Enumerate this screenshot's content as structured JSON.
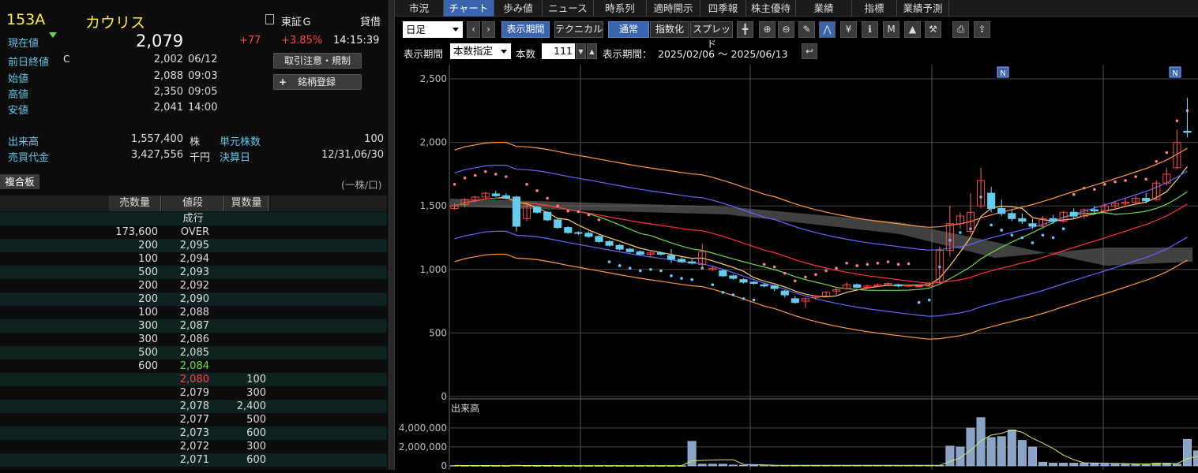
{
  "stock": {
    "code": "153A",
    "name": "カウリス",
    "market": "東証Ｇ",
    "lending": "貸借"
  },
  "quote": {
    "current_label": "現在値",
    "current_value": "2,079",
    "change": "+77",
    "change_pct": "+3.85%",
    "time": "14:15:39",
    "prev_close_label": "前日終値",
    "prev_close_mark": "C",
    "prev_close_value": "2,002",
    "prev_close_date": "06/12",
    "open_label": "始値",
    "open_value": "2,088",
    "open_time": "09:03",
    "high_label": "高値",
    "high_value": "2,350",
    "high_time": "09:05",
    "low_label": "安値",
    "low_value": "2,041",
    "low_time": "14:00",
    "volume_label": "出来高",
    "volume_value": "1,557,400",
    "volume_unit": "株",
    "unit_shares_label": "単元株数",
    "unit_shares_value": "100",
    "turnover_label": "売買代金",
    "turnover_value": "3,427,556",
    "turnover_unit": "千円",
    "settlement_label": "決算日",
    "settlement_value": "12/31,06/30"
  },
  "buttons": {
    "notice": "取引注意・規制",
    "register": "銘柄登録",
    "register_icon": "plus-icon"
  },
  "board": {
    "tab": "複合板",
    "unit_note": "(一株/口)",
    "headers": [
      "売数量",
      "値段",
      "買数量"
    ],
    "rows": [
      {
        "sell": "",
        "price": "成行",
        "buy": "",
        "price_color": "#dddddd"
      },
      {
        "sell": "173,600",
        "price": "OVER",
        "buy": "",
        "price_color": "#dddddd"
      },
      {
        "sell": "200",
        "price": "2,095",
        "buy": "",
        "price_color": "#dddddd"
      },
      {
        "sell": "100",
        "price": "2,094",
        "buy": "",
        "price_color": "#dddddd"
      },
      {
        "sell": "500",
        "price": "2,093",
        "buy": "",
        "price_color": "#dddddd"
      },
      {
        "sell": "200",
        "price": "2,092",
        "buy": "",
        "price_color": "#dddddd"
      },
      {
        "sell": "200",
        "price": "2,090",
        "buy": "",
        "price_color": "#dddddd"
      },
      {
        "sell": "100",
        "price": "2,088",
        "buy": "",
        "price_color": "#dddddd"
      },
      {
        "sell": "300",
        "price": "2,087",
        "buy": "",
        "price_color": "#dddddd"
      },
      {
        "sell": "300",
        "price": "2,086",
        "buy": "",
        "price_color": "#dddddd"
      },
      {
        "sell": "500",
        "price": "2,085",
        "buy": "",
        "price_color": "#dddddd"
      },
      {
        "sell": "600",
        "price": "2,084",
        "buy": "",
        "price_color": "#66dd44"
      },
      {
        "sell": "",
        "price": "2,080",
        "buy": "100",
        "price_color": "#ff4444"
      },
      {
        "sell": "",
        "price": "2,079",
        "buy": "300",
        "price_color": "#dddddd"
      },
      {
        "sell": "",
        "price": "2,078",
        "buy": "2,400",
        "price_color": "#dddddd"
      },
      {
        "sell": "",
        "price": "2,077",
        "buy": "500",
        "price_color": "#dddddd"
      },
      {
        "sell": "",
        "price": "2,073",
        "buy": "600",
        "price_color": "#dddddd"
      },
      {
        "sell": "",
        "price": "2,072",
        "buy": "300",
        "price_color": "#dddddd"
      },
      {
        "sell": "",
        "price": "2,071",
        "buy": "600",
        "price_color": "#dddddd"
      }
    ]
  },
  "tabs": [
    "市況",
    "チャート",
    "歩み値",
    "ニュース",
    "時系列",
    "適時開示",
    "四季報",
    "株主優待",
    "業績",
    "指標",
    "業績予測"
  ],
  "active_tab": "チャート",
  "toolbar": {
    "period_select": "日足",
    "display_period_btn": "表示期間",
    "technical_btn": "テクニカル",
    "mode_normal": "通常",
    "mode_index": "指数化",
    "mode_spread": "スプレッド",
    "icons": [
      "crosshair-icon",
      "zoom-in-icon",
      "zoom-out-icon",
      "pencil-icon",
      "trend-icon",
      "yen-icon",
      "info-icon",
      "my-chart-icon",
      "area-chart-icon",
      "wrench-icon",
      "print-icon",
      "export-icon"
    ],
    "row2_label": "表示期間",
    "row2_select": "本数指定",
    "count_label": "本数",
    "count_value": "111",
    "range_label": "表示期間：",
    "range_value": "2025/02/06 ～ 2025/06/13",
    "reset_icon": "return-icon"
  },
  "colors": {
    "up": "#ff4444",
    "down": "#66dd44",
    "accent": "#3a64ae",
    "cyan": "#5cc8e6",
    "yellow": "#ffee33"
  },
  "chart_data": {
    "type": "candlestick",
    "ylabels": [
      "2,500",
      "2,000",
      "1,500",
      "1,000",
      "500",
      "0"
    ],
    "yvals": [
      2500,
      2000,
      1500,
      1000,
      500,
      0
    ],
    "ylim": [
      0,
      2500
    ],
    "marker_label": "N",
    "volume_title": "出来高",
    "volume_labels": [
      "4,000,000",
      "2,000,000",
      "0"
    ],
    "volume_vals": [
      4000000,
      2000000,
      0
    ],
    "volume_ylim": [
      0,
      5400000
    ],
    "candles": [
      [
        1480,
        1520,
        1470,
        1500
      ],
      [
        1510,
        1560,
        1490,
        1550
      ],
      [
        1545,
        1580,
        1530,
        1570
      ],
      [
        1570,
        1610,
        1555,
        1600
      ],
      [
        1595,
        1620,
        1570,
        1580
      ],
      [
        1580,
        1600,
        1550,
        1560
      ],
      [
        1570,
        1580,
        1300,
        1340
      ],
      [
        1400,
        1510,
        1380,
        1500
      ],
      [
        1490,
        1500,
        1440,
        1450
      ],
      [
        1450,
        1460,
        1380,
        1390
      ],
      [
        1390,
        1400,
        1320,
        1330
      ],
      [
        1330,
        1340,
        1280,
        1290
      ],
      [
        1290,
        1300,
        1270,
        1285
      ],
      [
        1285,
        1300,
        1250,
        1260
      ],
      [
        1260,
        1270,
        1210,
        1220
      ],
      [
        1220,
        1230,
        1180,
        1190
      ],
      [
        1190,
        1200,
        1150,
        1160
      ],
      [
        1160,
        1170,
        1130,
        1140
      ],
      [
        1140,
        1150,
        1110,
        1120
      ],
      [
        1120,
        1140,
        1100,
        1130
      ],
      [
        1130,
        1140,
        1110,
        1120
      ],
      [
        1110,
        1160,
        1050,
        1080
      ],
      [
        1080,
        1100,
        1050,
        1060
      ],
      [
        1060,
        1080,
        1040,
        1050
      ],
      [
        1040,
        1200,
        1000,
        1140
      ],
      [
        1000,
        1030,
        990,
        1010
      ],
      [
        990,
        1000,
        940,
        950
      ],
      [
        950,
        960,
        920,
        930
      ],
      [
        920,
        930,
        890,
        900
      ],
      [
        900,
        910,
        880,
        890
      ],
      [
        880,
        890,
        860,
        870
      ],
      [
        870,
        880,
        830,
        850
      ],
      [
        830,
        840,
        780,
        800
      ],
      [
        770,
        790,
        730,
        740
      ],
      [
        750,
        780,
        700,
        770
      ],
      [
        780,
        800,
        760,
        790
      ],
      [
        790,
        830,
        780,
        820
      ],
      [
        830,
        860,
        800,
        840
      ],
      [
        850,
        900,
        840,
        880
      ],
      [
        880,
        890,
        850,
        860
      ],
      [
        860,
        880,
        850,
        870
      ],
      [
        870,
        890,
        860,
        880
      ],
      [
        880,
        900,
        870,
        890
      ],
      [
        880,
        890,
        860,
        870
      ],
      [
        870,
        880,
        860,
        875
      ],
      [
        870,
        880,
        860,
        870
      ],
      [
        870,
        900,
        860,
        890
      ],
      [
        900,
        1180,
        890,
        1150
      ],
      [
        1150,
        1500,
        1100,
        1360
      ],
      [
        1360,
        1450,
        1320,
        1420
      ],
      [
        1300,
        1600,
        1280,
        1450
      ],
      [
        1500,
        1800,
        1480,
        1700
      ],
      [
        1600,
        1650,
        1450,
        1480
      ],
      [
        1480,
        1550,
        1420,
        1440
      ],
      [
        1440,
        1470,
        1380,
        1400
      ],
      [
        1400,
        1440,
        1360,
        1380
      ],
      [
        1360,
        1400,
        1320,
        1340
      ],
      [
        1340,
        1420,
        1330,
        1400
      ],
      [
        1400,
        1430,
        1360,
        1380
      ],
      [
        1380,
        1460,
        1370,
        1450
      ],
      [
        1450,
        1480,
        1400,
        1420
      ],
      [
        1420,
        1480,
        1400,
        1470
      ],
      [
        1470,
        1500,
        1440,
        1460
      ],
      [
        1460,
        1520,
        1440,
        1500
      ],
      [
        1500,
        1540,
        1470,
        1520
      ],
      [
        1520,
        1560,
        1490,
        1530
      ],
      [
        1530,
        1580,
        1510,
        1560
      ],
      [
        1560,
        1600,
        1520,
        1540
      ],
      [
        1550,
        1700,
        1540,
        1680
      ],
      [
        1680,
        1800,
        1660,
        1750
      ],
      [
        1800,
        2100,
        1790,
        2000
      ],
      [
        2088,
        2350,
        2041,
        2079
      ]
    ],
    "volumes": [
      50000,
      40000,
      40000,
      30000,
      30000,
      30000,
      80000,
      40000,
      30000,
      30000,
      30000,
      30000,
      30000,
      30000,
      30000,
      30000,
      30000,
      30000,
      30000,
      30000,
      30000,
      30000,
      30000,
      2600000,
      200000,
      200000,
      200000,
      100000,
      80000,
      70000,
      70000,
      60000,
      60000,
      60000,
      60000,
      60000,
      60000,
      60000,
      60000,
      60000,
      60000,
      60000,
      60000,
      60000,
      60000,
      60000,
      60000,
      60000,
      2100000,
      2000000,
      4000000,
      5100000,
      3000000,
      3100000,
      3800000,
      2700000,
      2000000,
      400000,
      300000,
      300000,
      300000,
      300000,
      300000,
      200000,
      200000,
      200000,
      200000,
      200000,
      300000,
      300000,
      200000,
      2800000,
      1600000
    ]
  }
}
